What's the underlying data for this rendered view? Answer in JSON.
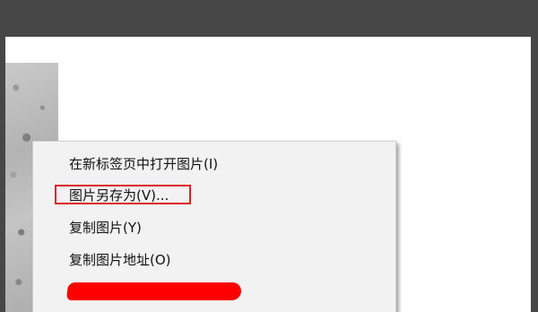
{
  "context_menu": {
    "items": [
      {
        "label": "在新标签页中打开图片(I)"
      },
      {
        "label": "图片另存为(V)..."
      },
      {
        "label": "复制图片(Y)"
      },
      {
        "label": "复制图片地址(O)"
      },
      {
        "label": ""
      }
    ]
  },
  "colors": {
    "window_frame": "#474747",
    "page_background": "#ffffff",
    "menu_background": "#f2f2f2",
    "highlight_border": "#d8232a",
    "redaction": "#ff0000"
  }
}
